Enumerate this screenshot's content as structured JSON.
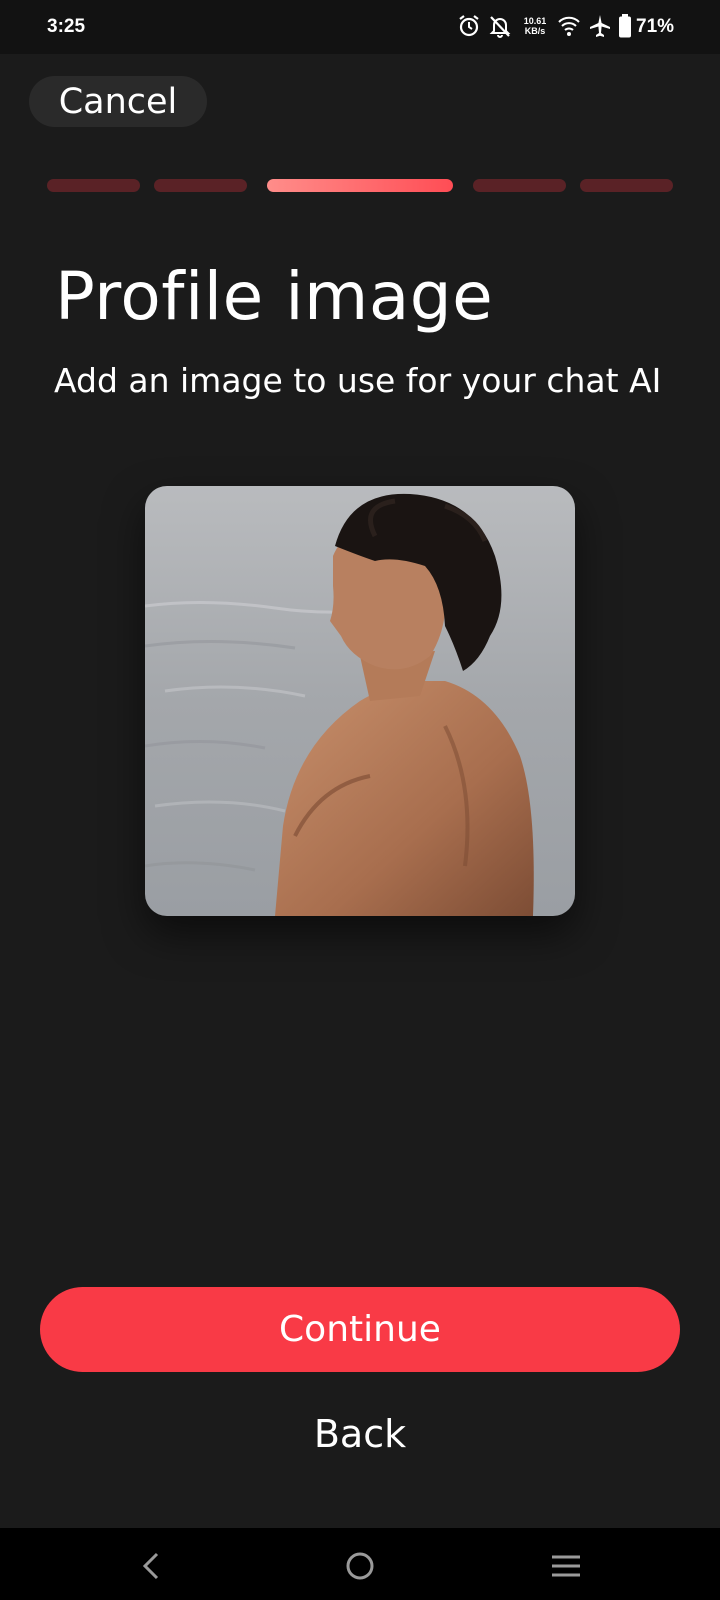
{
  "status_bar": {
    "time": "3:25",
    "net_speed_value": "10.61",
    "net_speed_unit": "KB/s",
    "battery_percent": "71%",
    "icons": [
      "alarm-icon",
      "bell-off-icon",
      "wifi-icon",
      "airplane-icon",
      "battery-icon"
    ]
  },
  "header": {
    "cancel_label": "Cancel"
  },
  "progress": {
    "total_steps": 5,
    "current_step": 3
  },
  "main": {
    "title": "Profile image",
    "subtitle": "Add an image to use for your chat AI"
  },
  "actions": {
    "continue_label": "Continue",
    "back_label": "Back"
  },
  "nav_bar": {
    "buttons": [
      "back-icon",
      "home-icon",
      "recents-icon"
    ]
  },
  "colors": {
    "background": "#1b1b1b",
    "accent": "#f93a46",
    "progress_inactive": "#5a2226",
    "progress_active": "#ff6b6e"
  }
}
